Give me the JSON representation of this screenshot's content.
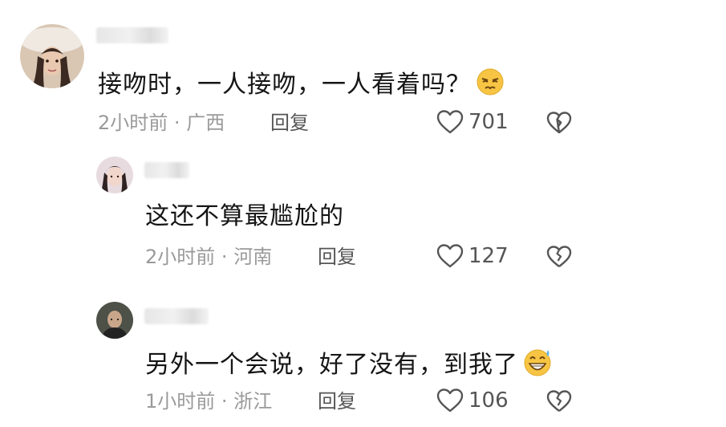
{
  "comments": [
    {
      "text": "接吻时，一人接吻，一人看着吗？",
      "emoji": "annoyed-face-emoji",
      "time": "2小时前",
      "separator": "·",
      "location": "广西",
      "reply_label": "回复",
      "likes": "701"
    },
    {
      "text": "这还不算最尴尬的",
      "time": "2小时前",
      "separator": "·",
      "location": "河南",
      "reply_label": "回复",
      "likes": "127"
    },
    {
      "text": "另外一个会说，好了没有，到我了",
      "emoji": "grinning-sweat-emoji",
      "time": "1小时前",
      "separator": "·",
      "location": "浙江",
      "reply_label": "回复",
      "likes": "106"
    }
  ],
  "colors": {
    "text": "#151515",
    "meta": "#9a9a9a",
    "action": "#555555"
  }
}
